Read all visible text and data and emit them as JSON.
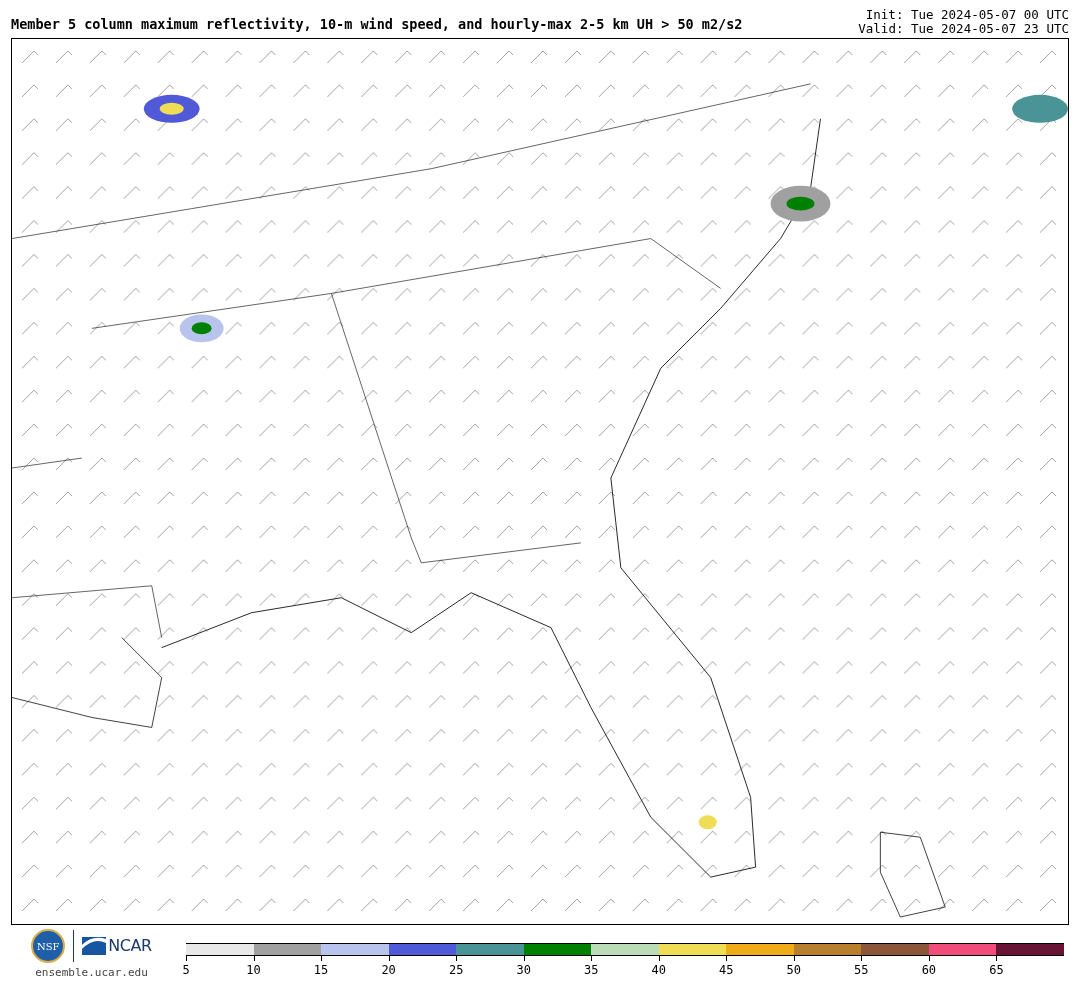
{
  "title": "Member 5 column maximum reflectivity, 10-m wind speed, and hourly-max 2-5 km UH > 50 m2/s2",
  "init": "Init: Tue 2024-05-07 00 UTC",
  "valid": "Valid: Tue 2024-05-07 23 UTC",
  "footer": {
    "logo_left": "NSF",
    "logo_right": "NCAR",
    "url": "ensemble.ucar.edu"
  },
  "colorbar": {
    "segments": [
      {
        "label": "5",
        "color": "#e8e8e8"
      },
      {
        "label": "10",
        "color": "#a0a0a0"
      },
      {
        "label": "15",
        "color": "#b8c4ec"
      },
      {
        "label": "20",
        "color": "#505ad8"
      },
      {
        "label": "25",
        "color": "#4a9396"
      },
      {
        "label": "30",
        "color": "#008000"
      },
      {
        "label": "35",
        "color": "#bcdcb8"
      },
      {
        "label": "40",
        "color": "#eedd55"
      },
      {
        "label": "45",
        "color": "#f0ac18"
      },
      {
        "label": "50",
        "color": "#b8802c"
      },
      {
        "label": "55",
        "color": "#8c563a"
      },
      {
        "label": "60",
        "color": "#f04c7c"
      },
      {
        "label": "65",
        "color": "#681434"
      }
    ]
  }
}
